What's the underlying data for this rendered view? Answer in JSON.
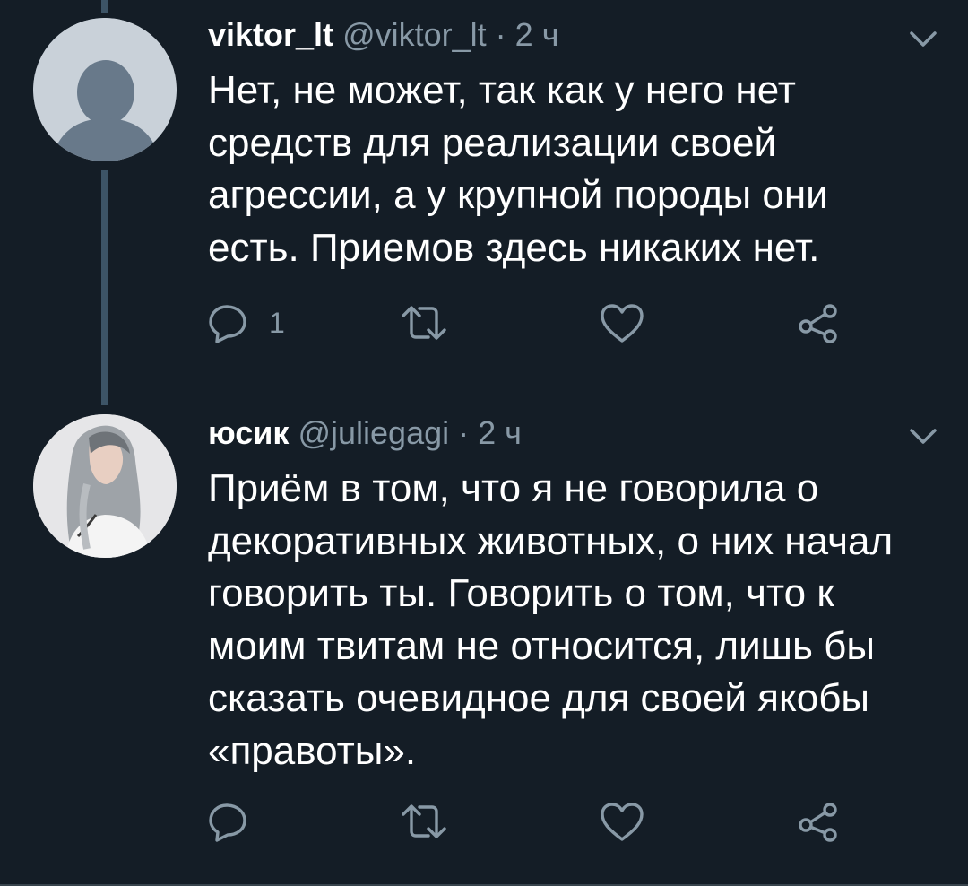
{
  "tweets": [
    {
      "display_name": "viktor_lt",
      "handle": "@viktor_lt",
      "separator": "·",
      "time": "2 ч",
      "text": "Нет, не может, так как у него нет средств для реализации своей агрессии, а у крупной породы они есть. Приемов здесь никаких нет.",
      "reply_count": "1",
      "avatar": "default-avatar-icon"
    },
    {
      "display_name": "юсик",
      "handle": "@juliegagi",
      "separator": "·",
      "time": "2 ч",
      "text": "Приём в том, что я не говорила о декоративных животных, о них начал говорить ты. Говорить о том, что к моим твитам не относится, лишь бы сказать очевидное для своей якобы «правоты».",
      "reply_count": "",
      "avatar": "user-photo"
    }
  ],
  "icons": [
    "chevron-down-icon",
    "reply-icon",
    "retweet-icon",
    "like-icon",
    "share-icon"
  ],
  "colors": {
    "background": "#141d26",
    "secondary_text": "#8899a6",
    "thread_line": "#3d5466"
  }
}
